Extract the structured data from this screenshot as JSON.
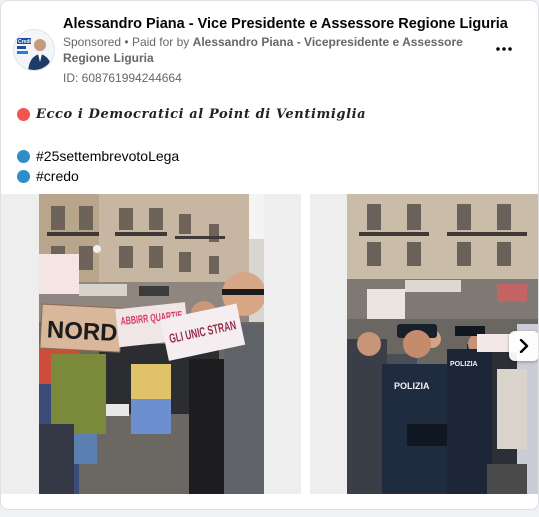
{
  "post": {
    "page_name": "Alessandro Piana - Vice Presidente e Assessore Regione Liguria",
    "sponsored_label": "Sponsored",
    "separator": "•",
    "paid_for_prefix": "Paid for by",
    "paid_for_by": "Alessandro Piana - Vicepresidente e Assessore Regione Liguria",
    "ad_id": "ID: 608761994244664",
    "more_icon": "more-options-icon"
  },
  "content": {
    "lines": [
      {
        "emoji_color": "#f25550",
        "text": "Ecco i Democratici al Point di Ventimiglia"
      },
      {
        "emoji_color": "#2f8ec9",
        "text": "#25settembrevotoLega"
      },
      {
        "emoji_color": "#2f8ec9",
        "text": "#credo"
      }
    ]
  },
  "carousel": {
    "next_icon": "chevron-right-icon",
    "slides": [
      {
        "signs": [
          "NORD",
          "ABBIRR QUARTIE",
          "GLI UNIC STRAN"
        ],
        "avatar_label": "Credi"
      },
      {
        "signs": [
          "POLIZIA",
          "POLIZIA"
        ]
      }
    ]
  },
  "colors": {
    "accent_red": "#f25550",
    "accent_blue": "#2f8ec9",
    "secondary_text": "#65676b"
  }
}
